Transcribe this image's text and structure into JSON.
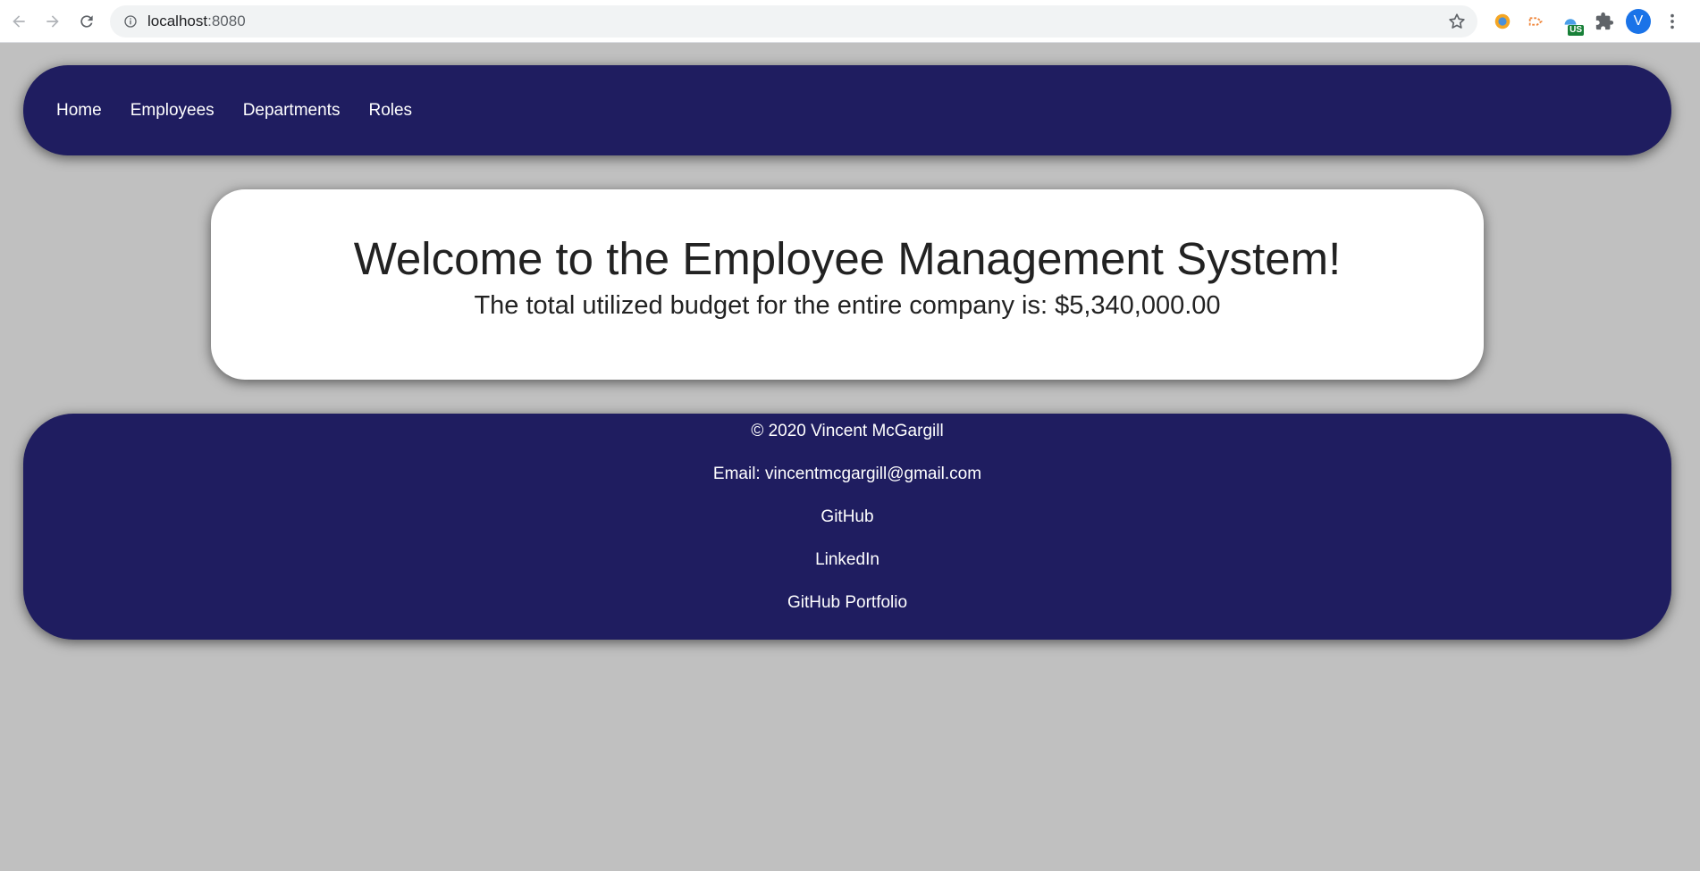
{
  "browser": {
    "url_host": "localhost",
    "url_port": ":8080",
    "profile_initial": "V",
    "extension_badge": "US"
  },
  "nav": {
    "links": [
      "Home",
      "Employees",
      "Departments",
      "Roles"
    ]
  },
  "hero": {
    "title": "Welcome to the Employee Management System!",
    "budget_text": "The total utilized budget for the entire company is: $5,340,000.00"
  },
  "footer": {
    "copyright": "© 2020 Vincent McGargill",
    "email": "Email: vincentmcgargill@gmail.com",
    "github": "GitHub",
    "linkedin": "LinkedIn",
    "portfolio": "GitHub Portfolio"
  },
  "colors": {
    "background": "#c0c0c0",
    "navy": "#1f1d60",
    "card": "#ffffff"
  }
}
